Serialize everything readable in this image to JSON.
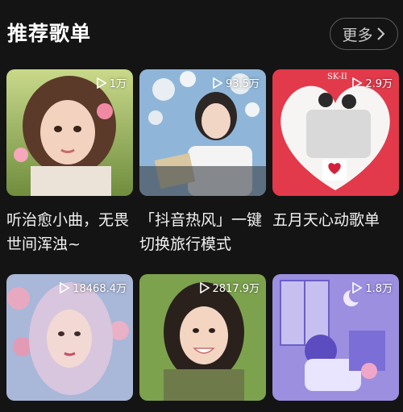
{
  "header": {
    "title": "推荐歌单",
    "more_label": "更多"
  },
  "playlists": [
    {
      "title": "听治愈小曲，无畏世间浑浊~",
      "play_count": "1万"
    },
    {
      "title": "「抖音热风」一键切换旅行模式",
      "play_count": "93.5万"
    },
    {
      "title": "五月天心动歌单",
      "play_count": "2.9万",
      "badge": "SK-II"
    },
    {
      "title": "",
      "play_count": "18468.4万"
    },
    {
      "title": "",
      "play_count": "2817.9万"
    },
    {
      "title": "",
      "play_count": "1.8万"
    }
  ],
  "icons": {
    "more": "chevron-right-icon",
    "play": "play-icon"
  },
  "colors": {
    "background": "#141414",
    "text": "#ffffff",
    "button_border": "#5a5a5a",
    "button_text": "#c9c9c9"
  }
}
